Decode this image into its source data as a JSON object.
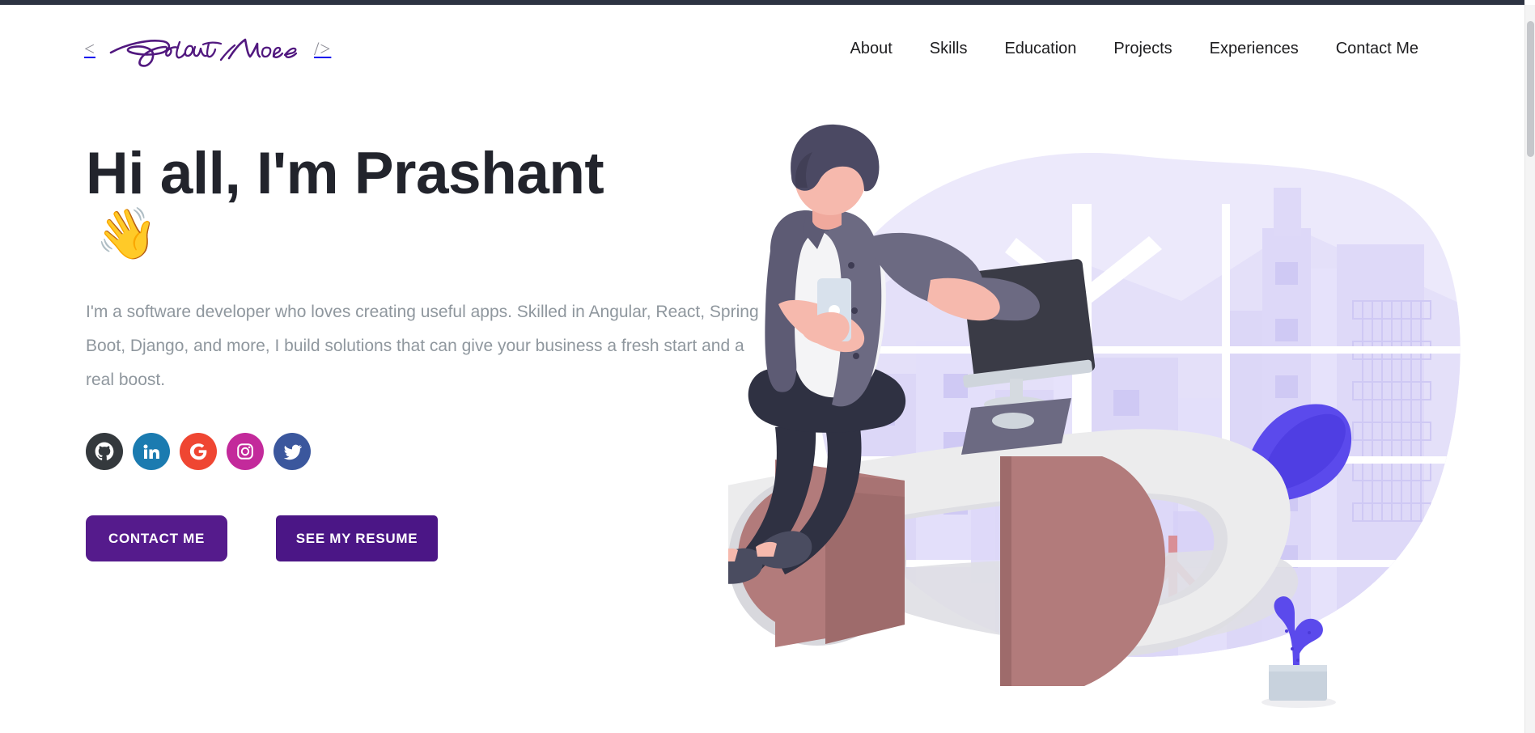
{
  "browser": {
    "scrollbar": "vertical-scrollbar"
  },
  "header": {
    "logo": {
      "open_bracket": "<",
      "close_bracket": "/>",
      "signature_text": "Prashant More",
      "signature_color": "#51187f"
    },
    "nav": [
      {
        "label": "About",
        "name": "nav-link-about"
      },
      {
        "label": "Skills",
        "name": "nav-link-skills"
      },
      {
        "label": "Education",
        "name": "nav-link-education"
      },
      {
        "label": "Projects",
        "name": "nav-link-projects"
      },
      {
        "label": "Experiences",
        "name": "nav-link-experiences"
      },
      {
        "label": "Contact Me",
        "name": "nav-link-contact-me"
      }
    ]
  },
  "hero": {
    "title": "Hi all, I'm Prashant",
    "wave_emoji": "👋",
    "paragraph": "I'm a software developer who loves creating useful apps. Skilled in Angular, React, Spring Boot, Django, and more, I build solutions that can give your business a fresh start and a real boost.",
    "social": [
      {
        "name": "github-icon",
        "label": "GitHub",
        "color": "#34393d"
      },
      {
        "name": "linkedin-icon",
        "label": "LinkedIn",
        "color": "#1b7bb0"
      },
      {
        "name": "google-icon",
        "label": "Google",
        "color": "#ef4632"
      },
      {
        "name": "instagram-icon",
        "label": "Instagram",
        "color": "#c32a9b"
      },
      {
        "name": "twitter-icon",
        "label": "Twitter",
        "color": "#3b579d"
      }
    ],
    "buttons": {
      "contact": "CONTACT ME",
      "resume": "SEE MY RESUME"
    },
    "illustration": {
      "name": "developer-at-desk-illustration",
      "description": "Flat illustration of a young man sitting on a desk looking at his phone, with a monitor, office chair and a potted cactus, in front of a pale lavender city skyline blob",
      "colors": {
        "blob": "#ece9fb",
        "building": "#dcd7f7",
        "building_light": "#e8e5fb",
        "window": "#cfc9f4",
        "chair": "#5b4aec",
        "chair_dark": "#4f3ee3",
        "desk": "#dedee3",
        "desk_top": "#ececed",
        "box": "#b27b7b",
        "box_dark": "#9e6b6b",
        "shirt": "#f4f4f6",
        "jacket": "#6c6a82",
        "jacket_dark": "#5d5b74",
        "hair": "#4b4963",
        "skin": "#f6b9ad",
        "pants": "#2f3142",
        "shoe": "#4a4c60",
        "monitor": "#3a3b46",
        "plant": "#5b4aec",
        "pot": "#c8d2dd",
        "chair_leg": "#d98f96"
      }
    }
  }
}
